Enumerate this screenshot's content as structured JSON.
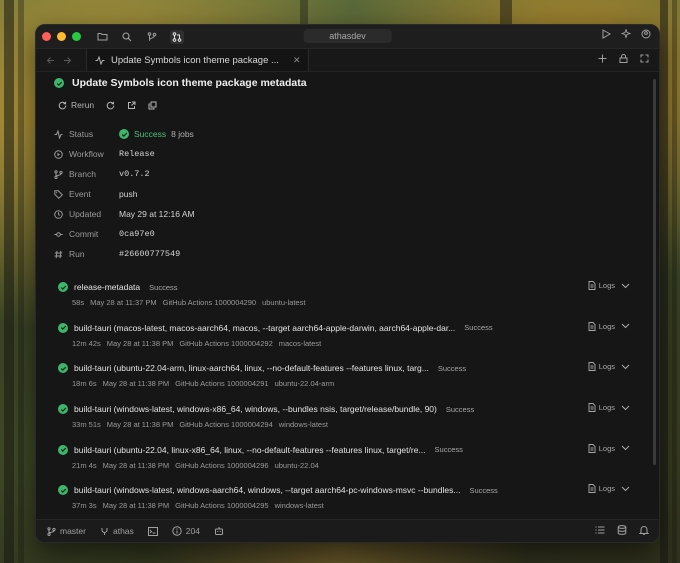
{
  "window": {
    "title": "athasdev"
  },
  "tab": {
    "label": "Update Symbols icon theme package ..."
  },
  "run": {
    "title": "Update Symbols icon theme package metadata",
    "actions": {
      "rerun_label": "Rerun"
    },
    "details": {
      "status_label": "Status",
      "status_value": "Success",
      "status_jobs": "8 jobs",
      "workflow_label": "Workflow",
      "workflow_value": "Release",
      "branch_label": "Branch",
      "branch_value": "v0.7.2",
      "event_label": "Event",
      "event_value": "push",
      "updated_label": "Updated",
      "updated_value": "May 29 at 12:16 AM",
      "commit_label": "Commit",
      "commit_value": "0ca97e0",
      "run_label": "Run",
      "run_value": "#26600777549"
    }
  },
  "jobs": [
    {
      "name": "release-metadata",
      "status": "Success",
      "duration": "58s",
      "time": "May 28 at 11:37 PM",
      "runner": "GitHub Actions 1000004290",
      "os": "ubuntu-latest",
      "logs": "Logs"
    },
    {
      "name": "build-tauri (macos-latest, macos-aarch64, macos, --target aarch64-apple-darwin, aarch64-apple-dar...",
      "status": "Success",
      "duration": "12m 42s",
      "time": "May 28 at 11:38 PM",
      "runner": "GitHub Actions 1000004292",
      "os": "macos-latest",
      "logs": "Logs"
    },
    {
      "name": "build-tauri (ubuntu-22.04-arm, linux-aarch64, linux, --no-default-features --features linux, targ...",
      "status": "Success",
      "duration": "18m 6s",
      "time": "May 28 at 11:38 PM",
      "runner": "GitHub Actions 1000004291",
      "os": "ubuntu-22.04-arm",
      "logs": "Logs"
    },
    {
      "name": "build-tauri (windows-latest, windows-x86_64, windows, --bundles nsis, target/release/bundle, 90)",
      "status": "Success",
      "duration": "33m 51s",
      "time": "May 28 at 11:38 PM",
      "runner": "GitHub Actions 1000004294",
      "os": "windows-latest",
      "logs": "Logs"
    },
    {
      "name": "build-tauri (ubuntu-22.04, linux-x86_64, linux, --no-default-features --features linux, target/re...",
      "status": "Success",
      "duration": "21m 4s",
      "time": "May 28 at 11:38 PM",
      "runner": "GitHub Actions 1000004296",
      "os": "ubuntu-22.04",
      "logs": "Logs"
    },
    {
      "name": "build-tauri (windows-latest, windows-aarch64, windows, --target aarch64-pc-windows-msvc --bundles...",
      "status": "Success",
      "duration": "37m 3s",
      "time": "May 28 at 11:38 PM",
      "runner": "GitHub Actions 1000004295",
      "os": "windows-latest",
      "logs": "Logs"
    }
  ],
  "statusbar": {
    "branch": "master",
    "project": "athas",
    "count": "204"
  },
  "colors": {
    "success": "#3fb56b",
    "close": "#ff5f57",
    "minimize": "#febc2e",
    "zoom": "#28c840"
  }
}
